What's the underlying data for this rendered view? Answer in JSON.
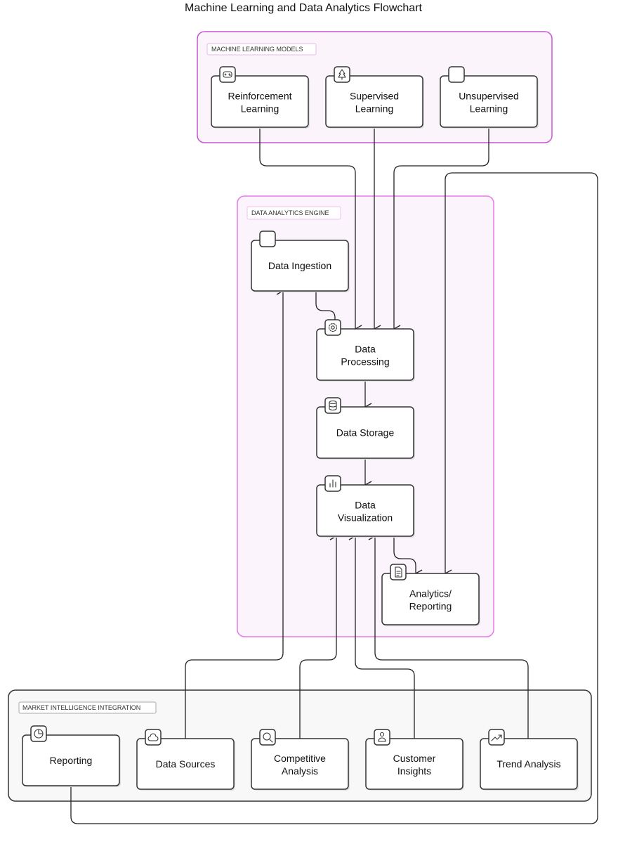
{
  "title": "Machine Learning and Data Analytics Flowchart",
  "colors": {
    "ml_group_stroke": "#c656d1",
    "ml_group_fill": "#fbf4fb",
    "engine_group_stroke": "#e77be8",
    "engine_group_fill": "#fcf4fc",
    "market_group_stroke": "#333333",
    "market_group_fill": "#f8f8f8"
  },
  "groups": {
    "ml": {
      "label": "MACHINE LEARNING MODELS"
    },
    "engine": {
      "label": "DATA ANALYTICS ENGINE"
    },
    "market": {
      "label": "MARKET INTELLIGENCE INTEGRATION"
    }
  },
  "nodes": {
    "reinforcement": {
      "lines": [
        "Reinforcement",
        "Learning"
      ],
      "icon": "gamepad-icon"
    },
    "supervised": {
      "lines": [
        "Supervised",
        "Learning"
      ],
      "icon": "tree-icon"
    },
    "unsupervised": {
      "lines": [
        "Unsupervised",
        "Learning"
      ],
      "icon": "blank-icon"
    },
    "ingestion": {
      "lines": [
        "Data Ingestion"
      ],
      "icon": "blank-icon"
    },
    "processing": {
      "lines": [
        "Data",
        "Processing"
      ],
      "icon": "gear-icon"
    },
    "storage": {
      "lines": [
        "Data Storage"
      ],
      "icon": "database-icon"
    },
    "visualization": {
      "lines": [
        "Data",
        "Visualization"
      ],
      "icon": "bar-chart-icon"
    },
    "analytics": {
      "lines": [
        "Analytics/",
        "Reporting"
      ],
      "icon": "document-icon"
    },
    "reporting": {
      "lines": [
        "Reporting"
      ],
      "icon": "pie-chart-icon"
    },
    "sources": {
      "lines": [
        "Data Sources"
      ],
      "icon": "cloud-icon"
    },
    "competitive": {
      "lines": [
        "Competitive",
        "Analysis"
      ],
      "icon": "search-icon"
    },
    "customer": {
      "lines": [
        "Customer",
        "Insights"
      ],
      "icon": "user-icon"
    },
    "trend": {
      "lines": [
        "Trend Analysis"
      ],
      "icon": "trending-up-icon"
    }
  }
}
